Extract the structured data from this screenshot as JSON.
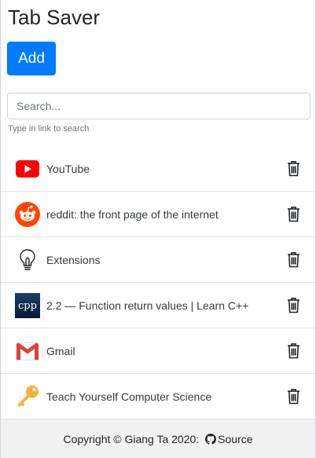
{
  "app": {
    "title": "Tab Saver"
  },
  "toolbar": {
    "add_label": "Add"
  },
  "search": {
    "placeholder": "Search...",
    "value": "",
    "helper": "Type in link to search"
  },
  "tabs": [
    {
      "title": "YouTube",
      "icon": "youtube-icon"
    },
    {
      "title": "reddit: the front page of the internet",
      "icon": "reddit-icon"
    },
    {
      "title": "Extensions",
      "icon": "extensions-bulb-icon"
    },
    {
      "title": "2.2 — Function return values | Learn C++",
      "icon": "cpp-icon"
    },
    {
      "title": "Gmail",
      "icon": "gmail-icon"
    },
    {
      "title": "Teach Yourself Computer Science",
      "icon": "key-icon"
    }
  ],
  "footer": {
    "copyright": "Copyright © Giang Ta 2020:",
    "source_label": "Source"
  },
  "colors": {
    "primary": "#007bff",
    "youtube": "#ff0000",
    "reddit": "#ff4500",
    "footer_bg": "#f1f1f1"
  }
}
